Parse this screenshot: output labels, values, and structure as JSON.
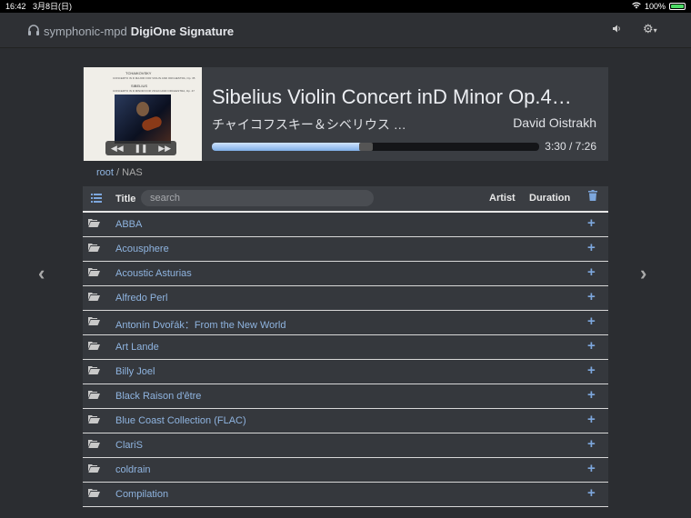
{
  "status": {
    "time": "16:42",
    "date": "3月8日(日)",
    "battery": "100%"
  },
  "navbar": {
    "brand_prefix": "symphonic-mpd",
    "brand_bold": "DigiOne Signature"
  },
  "cover": {
    "line1": "TCHAIKOVSKY",
    "line2": "CONCERTO IN D MAJOR FOR VIOLIN AND ORCHESTRA, Op. 35",
    "line3": "SIBELIUS",
    "line4": "CONCERTO IN D MINOR FOR VIOLIN AND ORCHESTRA, Op. 47"
  },
  "player": {
    "title": "Sibelius Violin Concert inD Minor Op.4…",
    "album": "チャイコフスキー＆シベリウス …",
    "artist": "David Oistrakh",
    "time": "3:30 / 7:26",
    "progress_fraction": 0.47
  },
  "breadcrumb": {
    "root": "root",
    "separator": "/",
    "current": "NAS"
  },
  "table": {
    "title_header": "Title",
    "search_placeholder": "search",
    "artist_header": "Artist",
    "duration_header": "Duration"
  },
  "rows": [
    "ABBA",
    "Acousphere",
    "Acoustic Asturias",
    "Alfredo Perl",
    "Antonín Dvořák：From the New World",
    "Art Lande",
    "Billy Joel",
    "Black Raison d'être",
    "Blue Coast Collection (FLAC)",
    "ClariS",
    "coldrain",
    "Compilation"
  ]
}
